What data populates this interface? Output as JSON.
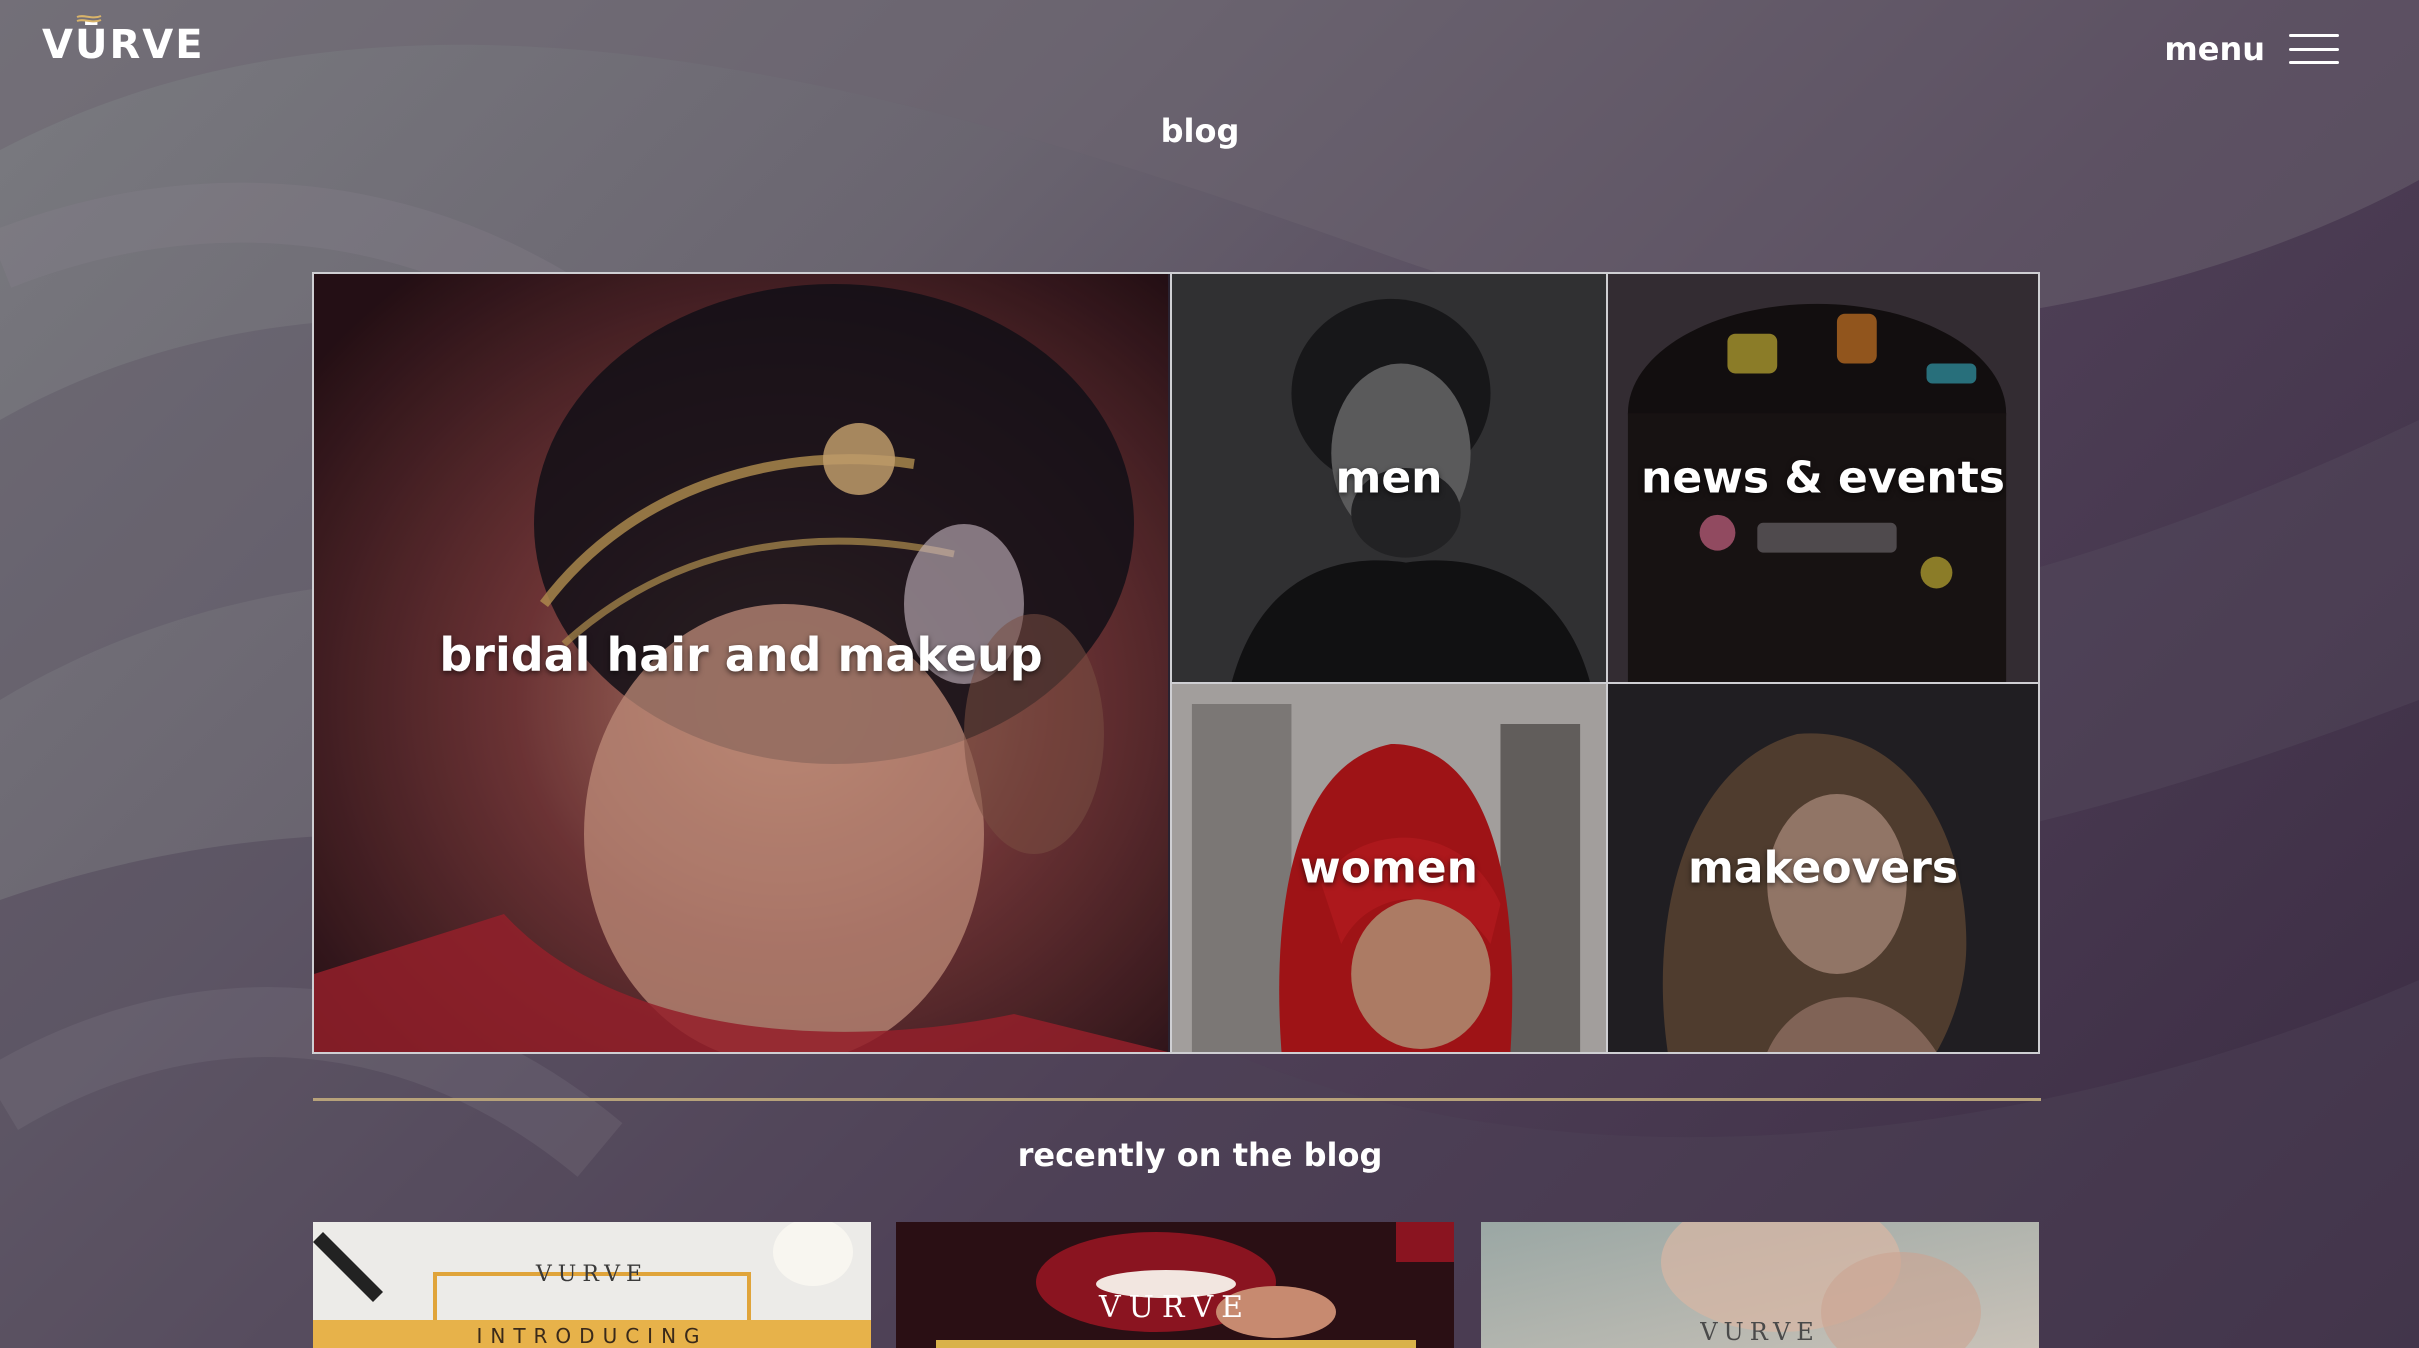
{
  "header": {
    "logo_text": "VŪRVE",
    "menu_label": "menu"
  },
  "page": {
    "title": "blog"
  },
  "categories": [
    {
      "label": "bridal hair and makeup"
    },
    {
      "label": "men"
    },
    {
      "label": "news & events"
    },
    {
      "label": "women"
    },
    {
      "label": "makeovers"
    }
  ],
  "recent": {
    "title": "recently on the blog",
    "cards": [
      {
        "brand": "VURVE",
        "caption": "INTRODUCING"
      },
      {
        "brand": "VURVE"
      },
      {
        "brand": "VURVE"
      }
    ]
  },
  "colors": {
    "divider": "#b7a27a",
    "grid_border": "#cfcfd3"
  },
  "icons": {
    "menu": "hamburger-icon"
  }
}
